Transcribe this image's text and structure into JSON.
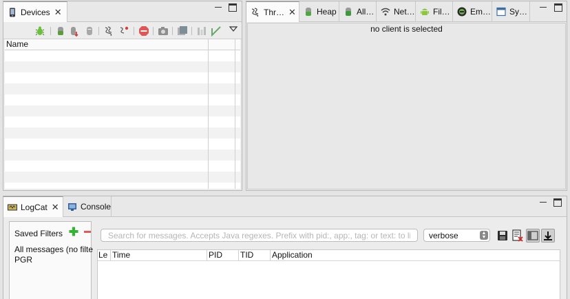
{
  "devices_view": {
    "tab_label": "Devices",
    "table_headers": [
      "Name"
    ],
    "toolbar_icons": [
      "debug-bug-icon",
      "heap-update-icon",
      "dump-hprof-icon",
      "cause-gc-icon",
      "thread-update-icon",
      "method-profiling-icon",
      "stop-process-icon",
      "screen-capture-icon",
      "systrace-icon",
      "opengl-trace-icon",
      "hierarchy-dump-icon",
      "view-menu-icon"
    ]
  },
  "threads_view": {
    "tabs": [
      {
        "label": "Thr…",
        "icon": "threads-icon"
      },
      {
        "label": "Heap",
        "icon": "heap-icon"
      },
      {
        "label": "All…",
        "icon": "allocation-tracker-icon"
      },
      {
        "label": "Net…",
        "icon": "network-statistics-icon"
      },
      {
        "label": "Fil…",
        "icon": "file-explorer-icon"
      },
      {
        "label": "Em…",
        "icon": "emulator-control-icon"
      },
      {
        "label": "Sy…",
        "icon": "system-information-icon"
      }
    ],
    "message": "no client is selected"
  },
  "logcat_view": {
    "tabs": [
      {
        "label": "LogCat",
        "icon": "logcat-icon"
      },
      {
        "label": "Console",
        "icon": "console-icon"
      }
    ],
    "saved_filters_title": "Saved Filters",
    "saved_filters": [
      "All messages (no filte",
      "PGR"
    ],
    "search_placeholder": "Search for messages. Accepts Java regexes. Prefix with pid:, app:, tag: or text: to lim",
    "log_level": "verbose",
    "columns": [
      "Le",
      "Time",
      "PID",
      "TID",
      "Application"
    ]
  },
  "colors": {
    "add_green": "#2fb52f",
    "remove_red": "#e05a5a",
    "stop_red": "#e05656"
  }
}
